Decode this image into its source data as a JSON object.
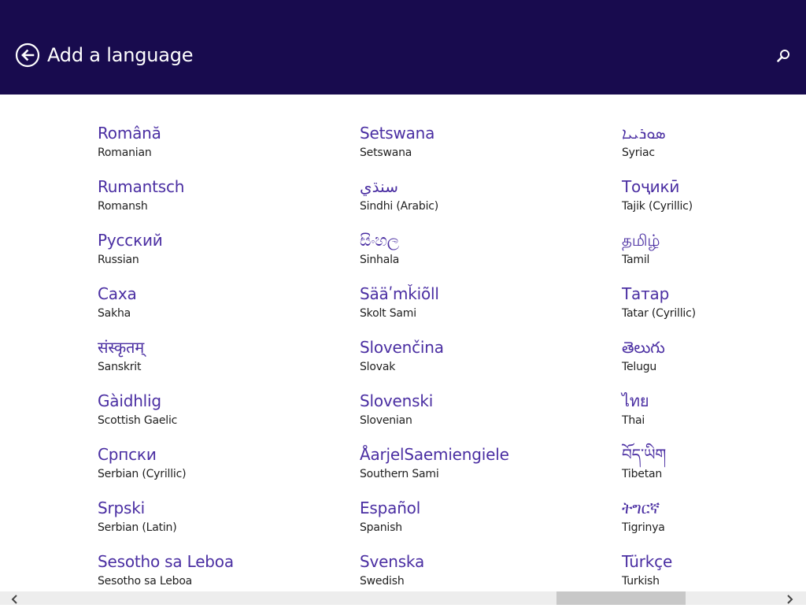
{
  "header": {
    "title": "Add a language",
    "background": "#180b4e",
    "back_icon": "back-arrow-circle-icon",
    "search_icon": "search-icon"
  },
  "languages": [
    [
      {
        "native": "Română",
        "english": "Romanian"
      },
      {
        "native": "Rumantsch",
        "english": "Romansh"
      },
      {
        "native": "Русский",
        "english": "Russian"
      },
      {
        "native": "Саха",
        "english": "Sakha"
      },
      {
        "native": "संस्कृतम्",
        "english": "Sanskrit"
      },
      {
        "native": "Gàidhlig",
        "english": "Scottish Gaelic"
      },
      {
        "native": "Српски",
        "english": "Serbian (Cyrillic)"
      },
      {
        "native": "Srpski",
        "english": "Serbian (Latin)"
      },
      {
        "native": "Sesotho sa Leboa",
        "english": "Sesotho sa Leboa"
      }
    ],
    [
      {
        "native": "Setswana",
        "english": "Setswana"
      },
      {
        "native": "سنڌي",
        "english": "Sindhi (Arabic)"
      },
      {
        "native": "සිංහල",
        "english": "Sinhala"
      },
      {
        "native": "Sääʹmǩiõll",
        "english": "Skolt Sami"
      },
      {
        "native": "Slovenčina",
        "english": "Slovak"
      },
      {
        "native": "Slovenski",
        "english": "Slovenian"
      },
      {
        "native": "ÅarjelSaemiengiele",
        "english": "Southern Sami"
      },
      {
        "native": "Español",
        "english": "Spanish"
      },
      {
        "native": "Svenska",
        "english": "Swedish"
      }
    ],
    [
      {
        "native": "ܣܘܪܝܝܐ",
        "english": "Syriac"
      },
      {
        "native": "Тоҷикӣ",
        "english": "Tajik (Cyrillic)"
      },
      {
        "native": "தமிழ்",
        "english": "Tamil"
      },
      {
        "native": "Татар",
        "english": "Tatar (Cyrillic)"
      },
      {
        "native": "తెలుగు",
        "english": "Telugu"
      },
      {
        "native": "ไทย",
        "english": "Thai"
      },
      {
        "native": "བོད་ཡིག",
        "english": "Tibetan"
      },
      {
        "native": "ትግርኛ",
        "english": "Tigrinya"
      },
      {
        "native": "Türkçe",
        "english": "Turkish"
      }
    ]
  ],
  "colors": {
    "accent": "#4a2ea2",
    "secondary_text": "#202020",
    "scrollbar_track": "#ededed",
    "scrollbar_thumb": "#c8c8c8"
  },
  "scrollbar": {
    "left_icon": "chevron-left-icon",
    "right_icon": "chevron-right-icon"
  }
}
